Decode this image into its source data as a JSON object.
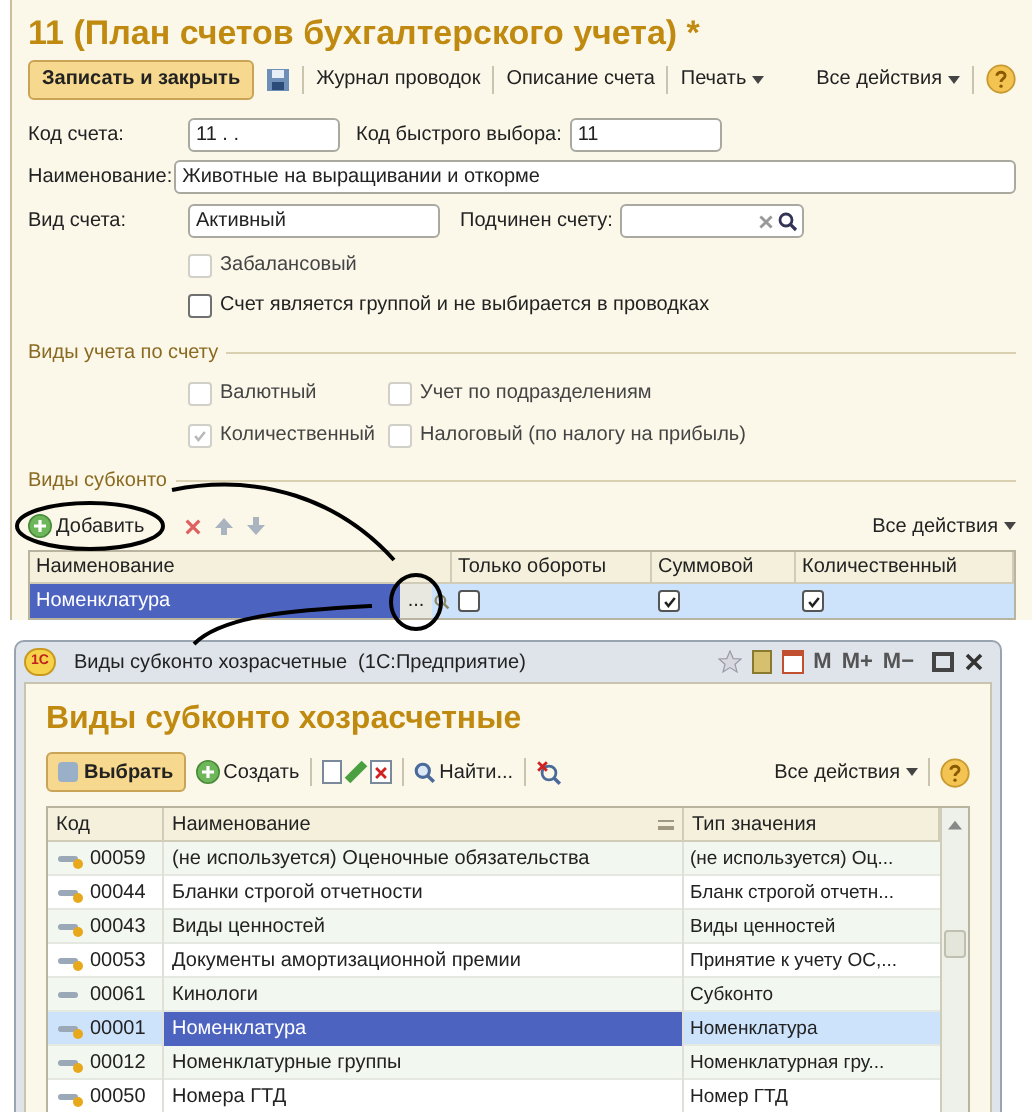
{
  "form": {
    "title": "11 (План счетов бухгалтерского учета) *",
    "toolbar": {
      "primary": "Записать и закрыть",
      "links": [
        "Журнал проводок",
        "Описание счета"
      ],
      "menu": "Печать",
      "all_actions": "Все действия"
    },
    "code_label": "Код счета:",
    "code_value": "11 . .",
    "quick_label": "Код быстрого выбора:",
    "quick_value": "11",
    "name_label": "Наименование:",
    "name_value": "Животные на выращивании и откорме",
    "type_label": "Вид счета:",
    "type_value": "Активный",
    "parent_label": "Подчинен счету:",
    "flags": [
      {
        "label": "Забалансовый",
        "checked": false,
        "disabled": true
      },
      {
        "label": "Счет является группой и не выбирается в проводках",
        "checked": false,
        "disabled": false
      }
    ],
    "accounting_title": "Виды учета по счету",
    "accounting": [
      {
        "label": "Валютный",
        "checked": false,
        "disabled": true
      },
      {
        "label": "Учет по подразделениям",
        "checked": false,
        "disabled": true
      },
      {
        "label": "Количественный",
        "checked": true,
        "disabled": true
      },
      {
        "label": "Налоговый (по налогу на прибыль)",
        "checked": false,
        "disabled": true
      }
    ],
    "subconto_title": "Виды субконто",
    "add_button": "Добавить",
    "subconto_all_actions": "Все действия",
    "subconto_columns": [
      "Наименование",
      "Только обороты",
      "Суммовой",
      "Количественный"
    ],
    "subconto_rows": [
      {
        "name": "Номенклатура",
        "ellipsis": "...",
        "turnover_only": false,
        "sum": true,
        "quantity": true,
        "selected": true
      }
    ]
  },
  "window": {
    "title": "Виды субконто хозрасчетные  (1С:Предприятие)",
    "logo": "1С",
    "memory_buttons": [
      "M",
      "M+",
      "M−"
    ],
    "heading": "Виды субконто хозрасчетные",
    "toolbar": {
      "select": "Выбрать",
      "create": "Создать",
      "find": "Найти...",
      "all_actions": "Все действия"
    },
    "columns": [
      "Код",
      "Наименование",
      "Тип значения"
    ],
    "rows": [
      {
        "code": "00059",
        "name": "(не используется) Оценочные обязательства",
        "type": "(не используется) Оц...",
        "kind": "marked",
        "selected": false
      },
      {
        "code": "00044",
        "name": "Бланки строгой отчетности",
        "type": "Бланк строгой отчетн...",
        "kind": "marked",
        "selected": false
      },
      {
        "code": "00043",
        "name": "Виды ценностей",
        "type": "Виды ценностей",
        "kind": "marked",
        "selected": false
      },
      {
        "code": "00053",
        "name": "Документы амортизационной премии",
        "type": "Принятие к учету ОС,...",
        "kind": "marked",
        "selected": false
      },
      {
        "code": "00061",
        "name": "Кинологи",
        "type": "Субконто",
        "kind": "plain",
        "selected": false
      },
      {
        "code": "00001",
        "name": "Номенклатура",
        "type": "Номенклатура",
        "kind": "marked",
        "selected": true
      },
      {
        "code": "00012",
        "name": "Номенклатурные группы",
        "type": "Номенклатурная гру...",
        "kind": "marked",
        "selected": false
      },
      {
        "code": "00050",
        "name": "Номера ГТД",
        "type": "Номер ГТД",
        "kind": "marked",
        "selected": false
      }
    ]
  }
}
